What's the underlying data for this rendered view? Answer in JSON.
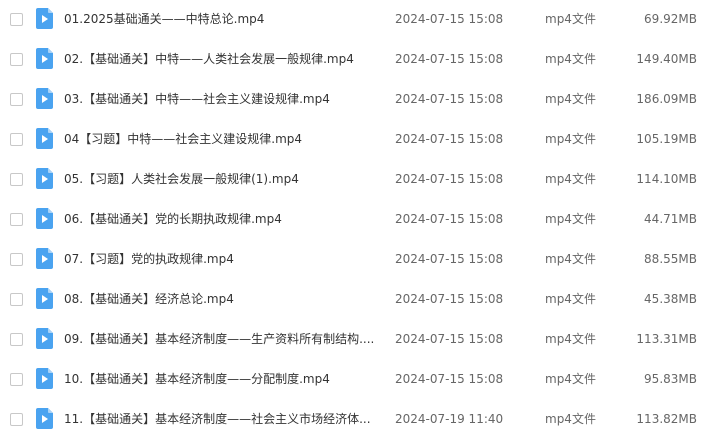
{
  "icons": {
    "file": "video-file-icon",
    "accent": "#4aa3f0"
  },
  "files": [
    {
      "name": "01.2025基础通关——中特总论.mp4",
      "date": "2024-07-15 15:08",
      "type": "mp4文件",
      "size": "69.92MB"
    },
    {
      "name": "02.【基础通关】中特——人类社会发展一般规律.mp4",
      "date": "2024-07-15 15:08",
      "type": "mp4文件",
      "size": "149.40MB"
    },
    {
      "name": "03.【基础通关】中特——社会主义建设规律.mp4",
      "date": "2024-07-15 15:08",
      "type": "mp4文件",
      "size": "186.09MB"
    },
    {
      "name": "04【习题】中特——社会主义建设规律.mp4",
      "date": "2024-07-15 15:08",
      "type": "mp4文件",
      "size": "105.19MB"
    },
    {
      "name": "05.【习题】人类社会发展一般规律(1).mp4",
      "date": "2024-07-15 15:08",
      "type": "mp4文件",
      "size": "114.10MB"
    },
    {
      "name": "06.【基础通关】党的长期执政规律.mp4",
      "date": "2024-07-15 15:08",
      "type": "mp4文件",
      "size": "44.71MB"
    },
    {
      "name": "07.【习题】党的执政规律.mp4",
      "date": "2024-07-15 15:08",
      "type": "mp4文件",
      "size": "88.55MB"
    },
    {
      "name": "08.【基础通关】经济总论.mp4",
      "date": "2024-07-15 15:08",
      "type": "mp4文件",
      "size": "45.38MB"
    },
    {
      "name": "09.【基础通关】基本经济制度——生产资料所有制结构....",
      "date": "2024-07-15 15:08",
      "type": "mp4文件",
      "size": "113.31MB"
    },
    {
      "name": "10.【基础通关】基本经济制度——分配制度.mp4",
      "date": "2024-07-15 15:08",
      "type": "mp4文件",
      "size": "95.83MB"
    },
    {
      "name": "11.【基础通关】基本经济制度——社会主义市场经济体...",
      "date": "2024-07-19 11:40",
      "type": "mp4文件",
      "size": "113.82MB"
    }
  ]
}
